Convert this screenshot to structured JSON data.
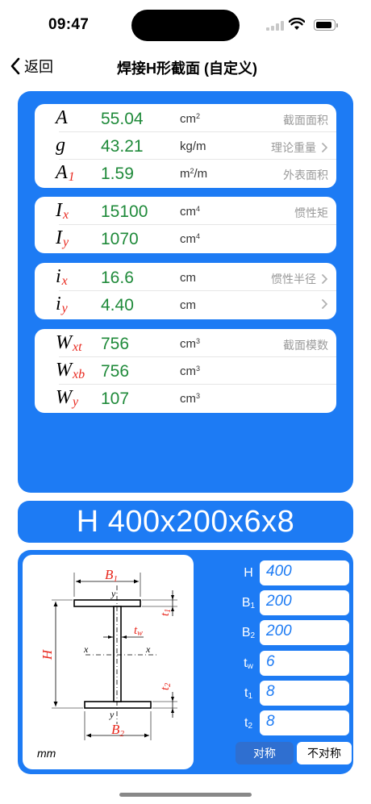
{
  "status": {
    "time": "09:47"
  },
  "nav": {
    "back_label": "返回",
    "title": "焊接H形截面 (自定义)"
  },
  "groups": [
    {
      "rows": [
        {
          "sym": "A",
          "sub": "",
          "value": "55.04",
          "unit": "cm",
          "sup": "2",
          "unit_tail": "",
          "label": "截面面积",
          "chevron": false
        },
        {
          "sym": "g",
          "sub": "",
          "value": "43.21",
          "unit": "kg/m",
          "sup": "",
          "unit_tail": "",
          "label": "理论重量",
          "chevron": true
        },
        {
          "sym": "A",
          "sub": "1",
          "value": "1.59",
          "unit": "m",
          "sup": "2",
          "unit_tail": "/m",
          "label": "外表面积",
          "chevron": false
        }
      ]
    },
    {
      "rows": [
        {
          "sym": "I",
          "sub": "x",
          "value": "15100",
          "unit": "cm",
          "sup": "4",
          "unit_tail": "",
          "label": "惯性矩",
          "chevron": false
        },
        {
          "sym": "I",
          "sub": "y",
          "value": "1070",
          "unit": "cm",
          "sup": "4",
          "unit_tail": "",
          "label": "",
          "chevron": false
        }
      ]
    },
    {
      "rows": [
        {
          "sym": "i",
          "sub": "x",
          "value": "16.6",
          "unit": "cm",
          "sup": "",
          "unit_tail": "",
          "label": "惯性半径",
          "chevron": true
        },
        {
          "sym": "i",
          "sub": "y",
          "value": "4.40",
          "unit": "cm",
          "sup": "",
          "unit_tail": "",
          "label": "",
          "chevron": true
        }
      ]
    },
    {
      "rows": [
        {
          "sym": "W",
          "sub": "xt",
          "value": "756",
          "unit": "cm",
          "sup": "3",
          "unit_tail": "",
          "label": "截面模数",
          "chevron": false
        },
        {
          "sym": "W",
          "sub": "xb",
          "value": "756",
          "unit": "cm",
          "sup": "3",
          "unit_tail": "",
          "label": "",
          "chevron": false
        },
        {
          "sym": "W",
          "sub": "y",
          "value": "107",
          "unit": "cm",
          "sup": "3",
          "unit_tail": "",
          "label": "",
          "chevron": false
        }
      ]
    }
  ],
  "section_title": "H 400x200x6x8",
  "diagram": {
    "labels": {
      "B1": "B",
      "B1_sub": "1",
      "B2": "B",
      "B2_sub": "2",
      "H": "H",
      "tw": "t",
      "tw_sub": "w",
      "t1": "t",
      "t1_sub": "1",
      "t2": "t",
      "t2_sub": "2",
      "x_left": "x",
      "x_right": "x",
      "y_top": "y",
      "y_bottom": "y"
    },
    "unit_label": "mm"
  },
  "inputs": [
    {
      "label": "H",
      "sub": "",
      "value": "400"
    },
    {
      "label": "B",
      "sub": "1",
      "value": "200"
    },
    {
      "label": "B",
      "sub": "2",
      "value": "200"
    },
    {
      "label": "t",
      "sub": "w",
      "value": "6"
    },
    {
      "label": "t",
      "sub": "1",
      "value": "8"
    },
    {
      "label": "t",
      "sub": "2",
      "value": "8"
    }
  ],
  "toggle": {
    "symmetric": "对称",
    "asymmetric": "不对称"
  },
  "colors": {
    "accent": "#1d7bf4",
    "value_green": "#1f8a3a",
    "subscript_red": "#e8281e"
  }
}
